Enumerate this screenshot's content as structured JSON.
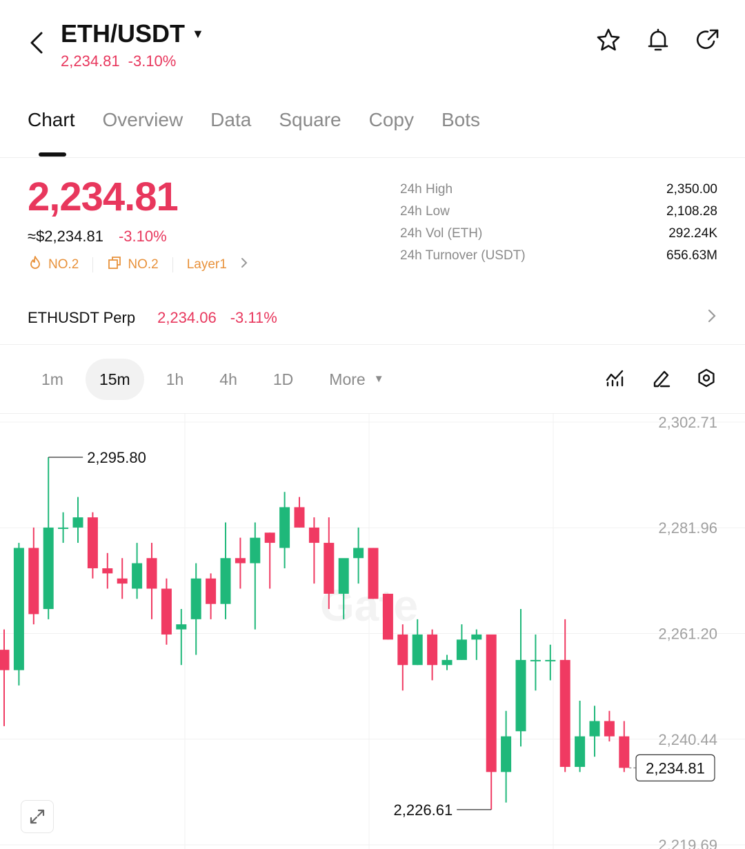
{
  "header": {
    "pair": "ETH/USDT",
    "price": "2,234.81",
    "change": "-3.10%",
    "icons": [
      "back-icon",
      "star-icon",
      "bell-icon",
      "share-icon"
    ]
  },
  "tabs": [
    "Chart",
    "Overview",
    "Data",
    "Square",
    "Copy",
    "Bots"
  ],
  "price_block": {
    "last": "2,234.81",
    "usd": "≈$2,234.81",
    "change": "-3.10%",
    "tags": [
      {
        "icon": "flame-icon",
        "label": "NO.2"
      },
      {
        "icon": "cube-icon",
        "label": "NO.2"
      },
      {
        "icon": "",
        "label": "Layer1"
      }
    ]
  },
  "stats": [
    {
      "label": "24h  High",
      "value": "2,350.00"
    },
    {
      "label": "24h  Low",
      "value": "2,108.28"
    },
    {
      "label": "24h  Vol (ETH)",
      "value": "292.24K"
    },
    {
      "label": "24h  Turnover (USDT)",
      "value": "656.63M"
    }
  ],
  "perp": {
    "name": "ETHUSDT Perp",
    "price": "2,234.06",
    "change": "-3.11%"
  },
  "intervals": {
    "items": [
      "1m",
      "15m",
      "1h",
      "4h",
      "1D"
    ],
    "active": "15m",
    "more": "More"
  },
  "colors": {
    "up": "#1fb87a",
    "down": "#f03a62",
    "accent_red": "#e8375d",
    "tag": "#e8913a"
  },
  "chart_data": {
    "type": "candlestick",
    "y_ticks": [
      "2,302.71",
      "2,281.96",
      "2,261.20",
      "2,240.44",
      "2,219.69"
    ],
    "ylim": [
      2219.69,
      2302.71
    ],
    "high_label": "2,295.80",
    "low_label": "2,226.61",
    "last_label": "2,234.81",
    "watermark": "Gate",
    "candles": [
      {
        "o": 2258.0,
        "h": 2262.0,
        "l": 2243.0,
        "c": 2254.0
      },
      {
        "o": 2254.0,
        "h": 2279.0,
        "l": 2251.0,
        "c": 2278.0
      },
      {
        "o": 2278.0,
        "h": 2282.0,
        "l": 2263.0,
        "c": 2265.0
      },
      {
        "o": 2266.0,
        "h": 2295.8,
        "l": 2264.0,
        "c": 2282.0
      },
      {
        "o": 2282.0,
        "h": 2285.0,
        "l": 2279.0,
        "c": 2282.0
      },
      {
        "o": 2282.0,
        "h": 2288.0,
        "l": 2279.0,
        "c": 2284.0
      },
      {
        "o": 2284.0,
        "h": 2285.0,
        "l": 2272.0,
        "c": 2274.0
      },
      {
        "o": 2274.0,
        "h": 2277.0,
        "l": 2270.0,
        "c": 2273.0
      },
      {
        "o": 2272.0,
        "h": 2276.0,
        "l": 2268.0,
        "c": 2271.0
      },
      {
        "o": 2270.0,
        "h": 2279.0,
        "l": 2268.0,
        "c": 2275.0
      },
      {
        "o": 2276.0,
        "h": 2279.0,
        "l": 2264.0,
        "c": 2270.0
      },
      {
        "o": 2270.0,
        "h": 2272.0,
        "l": 2259.0,
        "c": 2261.0
      },
      {
        "o": 2262.0,
        "h": 2266.0,
        "l": 2255.0,
        "c": 2263.0
      },
      {
        "o": 2264.0,
        "h": 2275.0,
        "l": 2257.0,
        "c": 2272.0
      },
      {
        "o": 2272.0,
        "h": 2273.0,
        "l": 2264.0,
        "c": 2267.0
      },
      {
        "o": 2267.0,
        "h": 2283.0,
        "l": 2264.0,
        "c": 2276.0
      },
      {
        "o": 2276.0,
        "h": 2280.0,
        "l": 2270.0,
        "c": 2275.0
      },
      {
        "o": 2275.0,
        "h": 2283.0,
        "l": 2262.0,
        "c": 2280.0
      },
      {
        "o": 2281.0,
        "h": 2281.0,
        "l": 2270.0,
        "c": 2279.0
      },
      {
        "o": 2278.0,
        "h": 2289.0,
        "l": 2274.0,
        "c": 2286.0
      },
      {
        "o": 2286.0,
        "h": 2288.0,
        "l": 2282.0,
        "c": 2282.0
      },
      {
        "o": 2282.0,
        "h": 2284.0,
        "l": 2271.0,
        "c": 2279.0
      },
      {
        "o": 2279.0,
        "h": 2284.0,
        "l": 2266.0,
        "c": 2269.0
      },
      {
        "o": 2269.0,
        "h": 2274.0,
        "l": 2264.0,
        "c": 2276.0
      },
      {
        "o": 2276.0,
        "h": 2282.0,
        "l": 2271.0,
        "c": 2278.0
      },
      {
        "o": 2278.0,
        "h": 2278.0,
        "l": 2268.0,
        "c": 2268.0
      },
      {
        "o": 2269.0,
        "h": 2269.0,
        "l": 2260.0,
        "c": 2260.0
      },
      {
        "o": 2261.0,
        "h": 2263.0,
        "l": 2250.0,
        "c": 2255.0
      },
      {
        "o": 2255.0,
        "h": 2264.0,
        "l": 2255.0,
        "c": 2261.0
      },
      {
        "o": 2261.0,
        "h": 2262.0,
        "l": 2252.0,
        "c": 2255.0
      },
      {
        "o": 2255.0,
        "h": 2257.0,
        "l": 2254.0,
        "c": 2256.0
      },
      {
        "o": 2256.0,
        "h": 2263.0,
        "l": 2256.0,
        "c": 2260.0
      },
      {
        "o": 2260.0,
        "h": 2262.0,
        "l": 2256.0,
        "c": 2261.0
      },
      {
        "o": 2261.0,
        "h": 2261.0,
        "l": 2226.61,
        "c": 2234.0
      },
      {
        "o": 2234.0,
        "h": 2246.0,
        "l": 2228.0,
        "c": 2241.0
      },
      {
        "o": 2242.0,
        "h": 2266.0,
        "l": 2239.0,
        "c": 2256.0
      },
      {
        "o": 2256.0,
        "h": 2261.0,
        "l": 2250.0,
        "c": 2256.0
      },
      {
        "o": 2256.0,
        "h": 2259.0,
        "l": 2252.0,
        "c": 2256.0
      },
      {
        "o": 2256.0,
        "h": 2264.0,
        "l": 2234.0,
        "c": 2235.0
      },
      {
        "o": 2235.0,
        "h": 2248.0,
        "l": 2234.0,
        "c": 2241.0
      },
      {
        "o": 2241.0,
        "h": 2247.0,
        "l": 2237.0,
        "c": 2244.0
      },
      {
        "o": 2244.0,
        "h": 2246.0,
        "l": 2240.0,
        "c": 2241.0
      },
      {
        "o": 2241.0,
        "h": 2244.0,
        "l": 2234.0,
        "c": 2234.81
      }
    ]
  }
}
